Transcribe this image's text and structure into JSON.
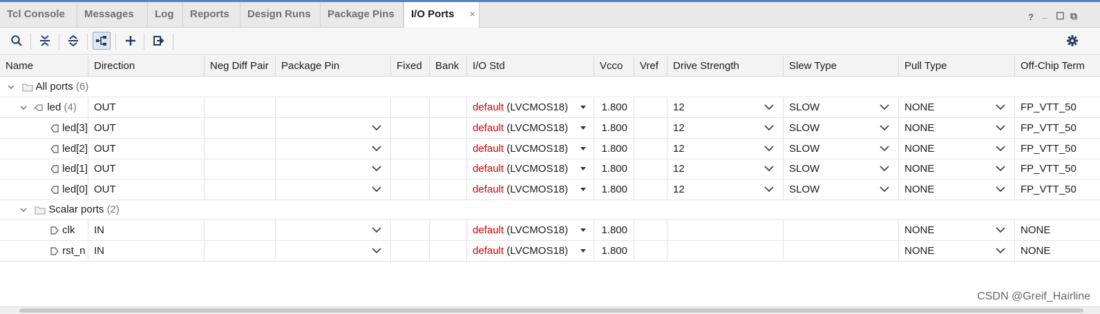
{
  "tabs": [
    {
      "label": "Tcl Console"
    },
    {
      "label": "Messages"
    },
    {
      "label": "Log"
    },
    {
      "label": "Reports"
    },
    {
      "label": "Design Runs"
    },
    {
      "label": "Package Pins"
    },
    {
      "label": "I/O Ports",
      "active": true
    }
  ],
  "tab_close": "×",
  "window_controls": {
    "help": "?",
    "minimize": "_",
    "maximize": "☐",
    "restore": "⧉"
  },
  "toolbar_icons": [
    "search-icon",
    "collapse-all-icon",
    "expand-all-icon",
    "group-by-interface-icon",
    "add-icon",
    "export-icon",
    "gear-icon"
  ],
  "columns": [
    "Name",
    "Direction",
    "Neg Diff Pair",
    "Package Pin",
    "Fixed",
    "Bank",
    "I/O Std",
    "Vcco",
    "Vref",
    "Drive Strength",
    "Slew Type",
    "Pull Type",
    "Off-Chip Term"
  ],
  "groups": {
    "all_ports": {
      "label": "All ports",
      "count": "(6)"
    },
    "led": {
      "name": "led",
      "count": "(4)",
      "direction": "OUT",
      "io_default": "default",
      "io_std": "(LVCMOS18)",
      "vcco": "1.800",
      "drive": "12",
      "slew": "SLOW",
      "pull": "NONE",
      "term": "FP_VTT_50"
    },
    "scalar": {
      "label": "Scalar ports",
      "count": "(2)"
    }
  },
  "led_rows": [
    {
      "name": "led[3]",
      "direction": "OUT",
      "io_default": "default",
      "io_std": "(LVCMOS18)",
      "vcco": "1.800",
      "drive": "12",
      "slew": "SLOW",
      "pull": "NONE",
      "term": "FP_VTT_50"
    },
    {
      "name": "led[2]",
      "direction": "OUT",
      "io_default": "default",
      "io_std": "(LVCMOS18)",
      "vcco": "1.800",
      "drive": "12",
      "slew": "SLOW",
      "pull": "NONE",
      "term": "FP_VTT_50"
    },
    {
      "name": "led[1]",
      "direction": "OUT",
      "io_default": "default",
      "io_std": "(LVCMOS18)",
      "vcco": "1.800",
      "drive": "12",
      "slew": "SLOW",
      "pull": "NONE",
      "term": "FP_VTT_50"
    },
    {
      "name": "led[0]",
      "direction": "OUT",
      "io_default": "default",
      "io_std": "(LVCMOS18)",
      "vcco": "1.800",
      "drive": "12",
      "slew": "SLOW",
      "pull": "NONE",
      "term": "FP_VTT_50"
    }
  ],
  "scalar_rows": [
    {
      "name": "clk",
      "direction": "IN",
      "io_default": "default",
      "io_std": "(LVCMOS18)",
      "vcco": "1.800",
      "pull": "NONE",
      "term": "NONE"
    },
    {
      "name": "rst_n",
      "direction": "IN",
      "io_default": "default",
      "io_std": "(LVCMOS18)",
      "vcco": "1.800",
      "pull": "NONE",
      "term": "NONE"
    }
  ],
  "watermark": "CSDN @Greif_Hairline",
  "colors": {
    "accent": "#4d84c7",
    "io_default": "#d40000",
    "icon": "#1f3a5f"
  }
}
